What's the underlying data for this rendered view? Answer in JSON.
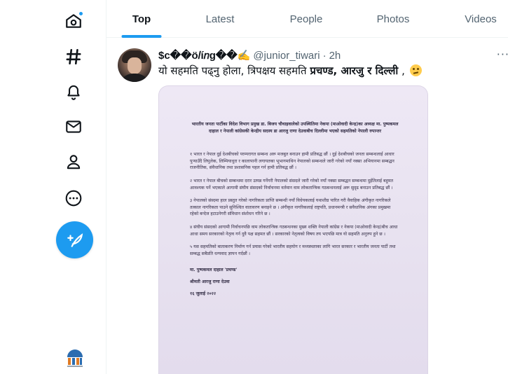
{
  "tabs": [
    {
      "label": "Top",
      "active": true
    },
    {
      "label": "Latest",
      "active": false
    },
    {
      "label": "People",
      "active": false
    },
    {
      "label": "Photos",
      "active": false
    },
    {
      "label": "Videos",
      "active": false
    }
  ],
  "sidebar": {
    "items": [
      {
        "icon": "home-icon",
        "notification": true
      },
      {
        "icon": "hashtag-icon"
      },
      {
        "icon": "bell-icon"
      },
      {
        "icon": "mail-icon"
      },
      {
        "icon": "profile-icon"
      },
      {
        "icon": "more-circle-icon"
      }
    ],
    "compose_icon": "feather-plus-icon",
    "accent": "#1d9bf0"
  },
  "tweet": {
    "display_name": "$c��ö𝑙í𝑛g��✍️",
    "handle": "@junior_tiwari",
    "separator": "·",
    "time": "2h",
    "more": "···",
    "text_part1": "यो सहमति पढ्नु होला, त्रिपक्षय सहमति ",
    "text_bold": "प्रचण्ड, आरजु र दिल्ली",
    "text_part2": " ,"
  },
  "document": {
    "heading": "भारतीय जनता पार्टीका विदेश विभाग प्रमुख डा. बिजय चौथाइवालेको उपस्थितिमा नेकपा (माओवादी केन्द्र)का अध्यक्ष मा. पुष्पकमल दाहाल र नेपाली कांग्रेसकी केन्द्रीय सदस्य डा आरजु राणा देउवाबीच दिल्लीमा भएको सहमतिको नेपाली रुपान्तर",
    "paragraphs": [
      "१ भारत र नेपाल दुई देशबीचको परम्परागत सम्बन्ध अरू मजबुत बनाउन हामी प्रतिबद्ध छौं । दुई देशबीचको जनता सम्बन्धलाई आधार पुऱ्याउँदै लिपुलेक, लिम्पियाधुरा र कालापानी लगायतका भूभागमाथिन नेपालको सम्बन्धले जारी गरेको नयाँ नक्सा अभियानमा सम्बद्धन राजनीतिक, संवैधानिक तथा प्रशासनिक पहल गर्न हामी प्रतिबद्ध छौं ।",
      "२ भारत र नेपाल बीचको सम्बन्धमा दरार उत्पन्न गर्नेगरी नेपालको संसदले जारी गरेको नयाँ नक्सा सम्बद्धन सम्बन्धमा दुईतिलाई बहुमत आवश्यक पर्ने भएकाले आगामी संघीय संसदको निर्वाचनमा वर्तमान वाम लोकतान्त्रिक गठबन्धनलाई अरू सुदृढ बनाउन प्रतिबद्ध छौं ।",
      "३ नेपालको संस्दमा हाल प्रस्तुत गरेको नागरिकता प्राप्ति सम्बन्धी नयाँ विधेयकलाई यथाशीघ्र पारित गरी वैवाहिक अंगीकृत नागरिकले तत्काल नागरिकता पाउने सुनिश्चित वातावरण बनाइने छ । अंगीकृत नागरिकलाई राष्ट्रपति, प्रधानमन्त्री र सवैधानिक अंगका प्रमुखमा रहेको बन्देज हटाउनेगरी संविधान संशोधन गरिने छ ।",
      "४ संघीय संसदको आगामी निर्वाचनपछि वाम लोकतान्त्रिक गठबन्धनका मुख्य शक्ति नेपाली कांग्रेस र नेकपा (माओवादी केन्द्र)बीच आधा आधा समय सरकारको नेतृत्व गर्न दुवै पक्ष सहमत छौं । सरकारको नेतृत्वको विषय तय भएपछि मात्र यो सहमति अनुरुप हुने छ ।",
      "५ यस सहमतिको बाताकरण निर्माण गर्न प्रयास गरेको भारतीय सहयोग र मध्यस्थताका लागि भारत सरकार र भारतीय जनता पार्टी तथा सम्बद्ध सबैप्रति धन्यवाद ज्ञापन गर्दछौं ।"
    ],
    "signatory1": "मा. पुष्पकमल दाहाल 'प्रचण्ड'",
    "signatory2": "श्रीमती आरजु राणा देउवा",
    "date": "१६ जुलाई २०२२"
  }
}
